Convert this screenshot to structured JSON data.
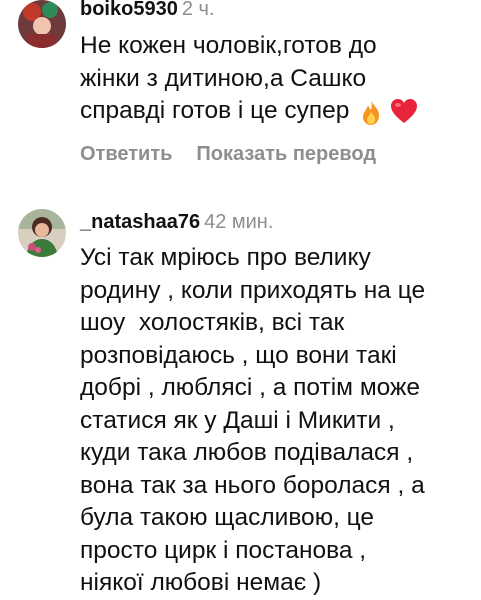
{
  "comments": [
    {
      "username": "boiko5930",
      "time": "2 ч.",
      "lines": [
        "Не кожен чоловік,готов до",
        "жінки з дитиною,а Сашко",
        "справді готов і це супер"
      ],
      "emojis": [
        "fire-icon",
        "red-heart-icon"
      ],
      "actions": {
        "reply": "Ответить",
        "translate": "Показать перевод"
      }
    },
    {
      "username": "_natashaa76",
      "time": "42 мин.",
      "lines": [
        "Усі так мріюсь про велику",
        "родину , коли приходять на це",
        "шоу  холостяків, всі так",
        "розповідаюсь , що вони такі",
        "добрі , люблясі , а потім може",
        "статися як у Даші і Микити ,",
        "куди така любов подівалася ,",
        "вона так за нього боролася , а",
        "була такою щасливою, це",
        "просто цирк і постанова ,",
        "ніякої любові немає )"
      ]
    }
  ],
  "colors": {
    "text": "#111111",
    "secondary": "#8e8e8e",
    "fire": "#f7931e",
    "heart": "#e8243b"
  }
}
